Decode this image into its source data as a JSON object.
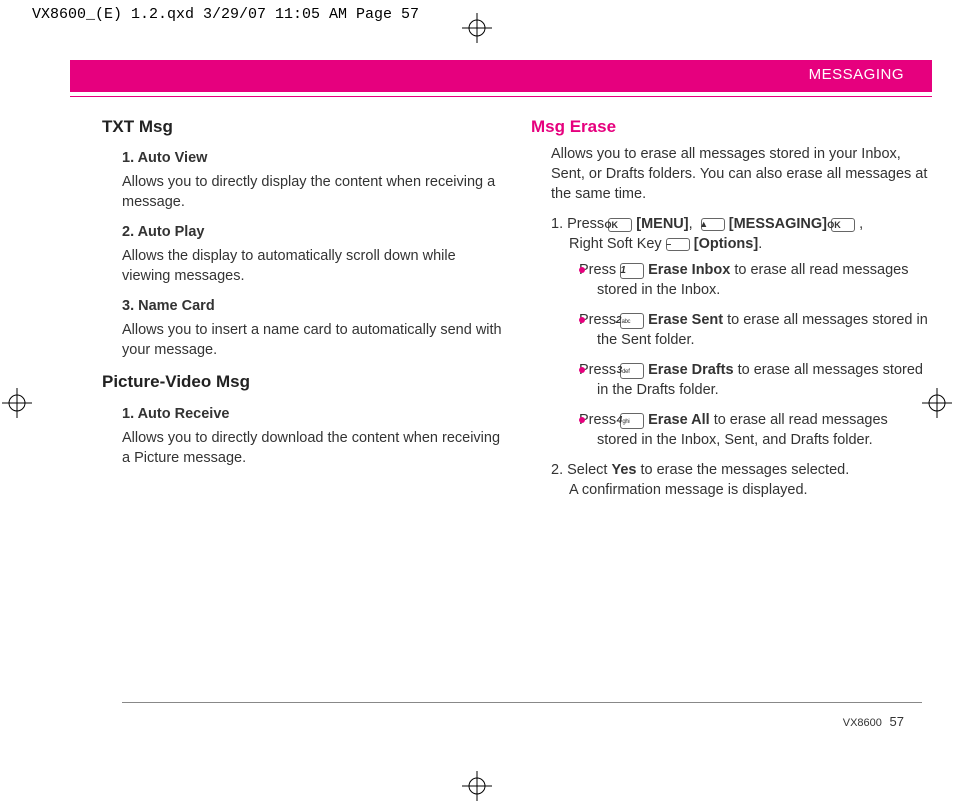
{
  "crop_marks": {
    "header": "VX8600_(E) 1.2.qxd  3/29/07  11:05 AM  Page 57"
  },
  "banner": {
    "label": "MESSAGING"
  },
  "left_column": {
    "section1_title": "TXT Msg",
    "s1_h1": "1. Auto View",
    "s1_p1": "Allows you to directly display the content when receiving a message.",
    "s1_h2": "2. Auto Play",
    "s1_p2": "Allows the display to automatically scroll down while viewing messages.",
    "s1_h3": "3. Name Card",
    "s1_p3": "Allows you to insert a name card to automatically send with your message.",
    "section2_title": "Picture-Video Msg",
    "s2_h1": "1. Auto Receive",
    "s2_p1": "Allows you to directly download the content when receiving a Picture message."
  },
  "right_column": {
    "section_title": "Msg Erase",
    "intro": "Allows you to erase all messages stored in your Inbox, Sent, or Drafts folders. You can also erase all messages at the same time.",
    "step1_prefix": "1.  Press ",
    "menu_label": " [MENU]",
    "messaging_label": " [MESSAGING] ",
    "softkey_line": "Right Soft Key ",
    "options_label": " [Options]",
    "bullets": {
      "b1_pre": "Press ",
      "b1_bold": " Erase Inbox",
      "b1_post": " to erase all read messages stored in the Inbox.",
      "b2_pre": "Press ",
      "b2_bold": " Erase Sent",
      "b2_post": " to erase all messages stored in the Sent folder.",
      "b3_pre": "Press ",
      "b3_bold": " Erase Drafts",
      "b3_post": " to erase all messages stored in the Drafts folder.",
      "b4_pre": "Press ",
      "b4_bold": " Erase All",
      "b4_post": " to erase all read messages stored in the Inbox, Sent, and Drafts folder."
    },
    "step2_a": "2.  Select ",
    "step2_bold": "Yes",
    "step2_b": " to erase the messages selected.",
    "step2_c": "A confirmation message is displayed."
  },
  "keys": {
    "ok": "OK",
    "up": "▲",
    "soft": "–",
    "k1n": "1",
    "k1t": "",
    "k2n": "2",
    "k2t": "abc",
    "k3n": "3",
    "k3t": "def",
    "k4n": "4",
    "k4t": "ghi"
  },
  "footer": {
    "model": "VX8600",
    "page": "57"
  }
}
